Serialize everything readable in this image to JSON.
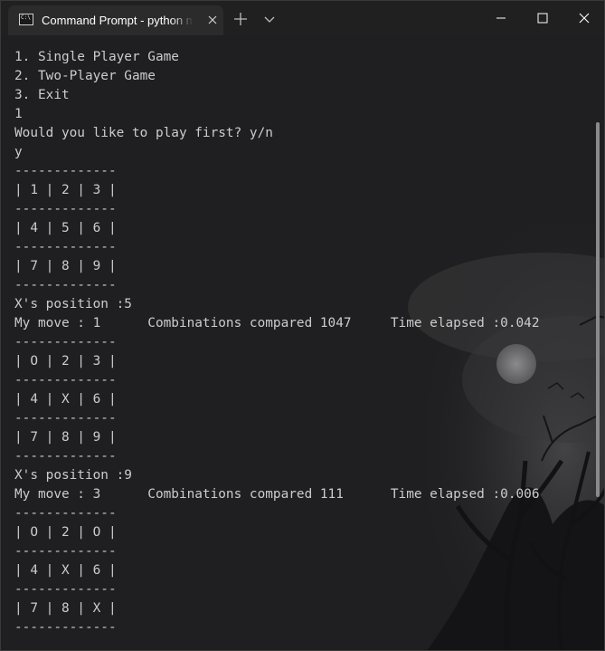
{
  "titlebar": {
    "tab_title": "Command Prompt - python main",
    "tab_icon_text": "C:\\"
  },
  "icons": {
    "tab_icon": "command-prompt-icon",
    "tab_close": "close-icon",
    "new_tab": "plus-icon",
    "dropdown": "chevron-down-icon",
    "minimize": "minimize-icon",
    "maximize": "maximize-icon",
    "close": "close-icon"
  },
  "colors": {
    "terminal_bg": "#1f1f21",
    "terminal_text": "#cccccc",
    "titlebar_bg": "#202020",
    "tab_bg": "#2b2b2b"
  },
  "terminal": {
    "lines": [
      "1. Single Player Game",
      "2. Two-Player Game",
      "3. Exit",
      "1",
      "Would you like to play first? y/n",
      "y",
      "-------------",
      "| 1 | 2 | 3 |",
      "-------------",
      "| 4 | 5 | 6 |",
      "-------------",
      "| 7 | 8 | 9 |",
      "-------------",
      "X's position :5",
      "My move : 1      Combinations compared 1047     Time elapsed :0.042",
      "-------------",
      "| O | 2 | 3 |",
      "-------------",
      "| 4 | X | 6 |",
      "-------------",
      "| 7 | 8 | 9 |",
      "-------------",
      "X's position :9",
      "My move : 3      Combinations compared 111      Time elapsed :0.006",
      "-------------",
      "| O | 2 | O |",
      "-------------",
      "| 4 | X | 6 |",
      "-------------",
      "| 7 | 8 | X |",
      "-------------"
    ]
  }
}
